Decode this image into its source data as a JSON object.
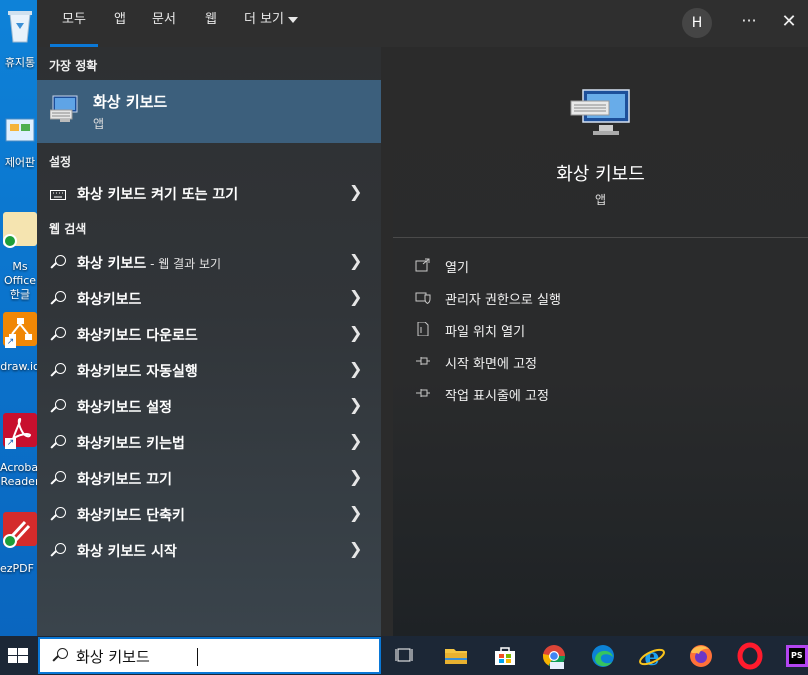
{
  "desktop": {
    "icons": [
      {
        "label": "휴지통"
      },
      {
        "label": "제어판"
      },
      {
        "label": "Ms Office 한글"
      },
      {
        "label": "draw.io"
      },
      {
        "label": "Acrobat Reader"
      },
      {
        "label": "ezPDF E"
      }
    ]
  },
  "tabs": [
    {
      "label": "모두"
    },
    {
      "label": "앱"
    },
    {
      "label": "문서"
    },
    {
      "label": "웹"
    },
    {
      "label": "더 보기"
    }
  ],
  "header": {
    "avatar": "H",
    "more": "···",
    "close": "✕"
  },
  "sections": {
    "best": "가장 정확",
    "settings": "설정",
    "web": "웹 검색"
  },
  "best_match": {
    "title": "화상 키보드",
    "type": "앱"
  },
  "settings_items": [
    {
      "label": "화상 키보드 켜기 또는 끄기"
    }
  ],
  "web_items": [
    {
      "label": "화상 키보드",
      "sub": " - 웹 결과 보기"
    },
    {
      "label": "화상키보드"
    },
    {
      "label": "화상키보드 다운로드"
    },
    {
      "label": "화상키보드 자동실행"
    },
    {
      "label": "화상키보드 설정"
    },
    {
      "label": "화상키보드 키는법"
    },
    {
      "label": "화상키보드 끄기"
    },
    {
      "label": "화상키보드 단축키"
    },
    {
      "label": "화상 키보드 시작"
    }
  ],
  "detail": {
    "title": "화상 키보드",
    "type": "앱",
    "actions": [
      {
        "label": "열기",
        "icon": "open-icon"
      },
      {
        "label": "관리자 권한으로 실행",
        "icon": "shield-icon"
      },
      {
        "label": "파일 위치 열기",
        "icon": "file-location-icon"
      },
      {
        "label": "시작 화면에 고정",
        "icon": "pin-icon"
      },
      {
        "label": "작업 표시줄에 고정",
        "icon": "pin-icon"
      }
    ]
  },
  "search": {
    "value": "화상 키보드"
  },
  "colors": {
    "accent": "#0a78d7",
    "selected": "#3c5f7c",
    "panel": "#2b2b2b"
  }
}
